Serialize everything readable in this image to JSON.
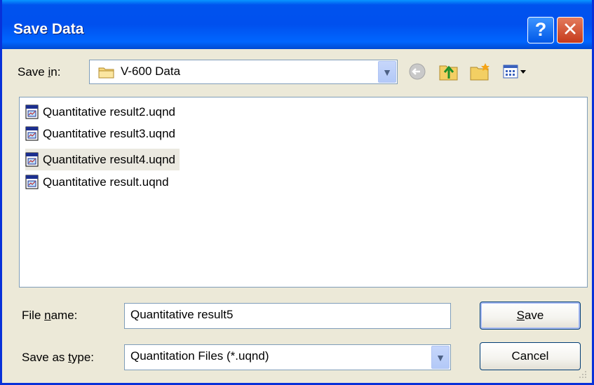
{
  "window": {
    "title": "Save Data",
    "help_glyph": "?",
    "close_glyph": "✕"
  },
  "save_in": {
    "label_prefix": "Save ",
    "label_mnemonic": "i",
    "label_suffix": "n:",
    "value": "V-600 Data"
  },
  "files": [
    {
      "name": "Quantitative result2.uqnd",
      "selected": false
    },
    {
      "name": "Quantitative result3.uqnd",
      "selected": false
    },
    {
      "name": "Quantitative result4.uqnd",
      "selected": true
    },
    {
      "name": "Quantitative result.uqnd",
      "selected": false
    }
  ],
  "file_name": {
    "label_prefix": "File ",
    "label_mnemonic": "n",
    "label_suffix": "ame:",
    "value": "Quantitative result5"
  },
  "save_as_type": {
    "label_prefix": "Save as ",
    "label_mnemonic": "t",
    "label_suffix": "ype:",
    "value": "Quantitation Files (*.uqnd)"
  },
  "buttons": {
    "save_mnemonic": "S",
    "save_rest": "ave",
    "cancel": "Cancel"
  },
  "colors": {
    "title_bar": "#0053ee",
    "dialog_bg": "#ece9d8",
    "close_button": "#c63a1b"
  }
}
